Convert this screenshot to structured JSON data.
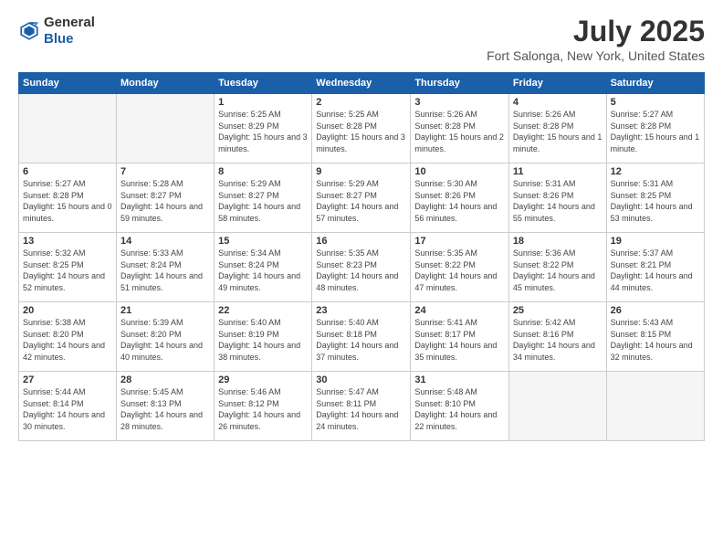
{
  "header": {
    "logo_general": "General",
    "logo_blue": "Blue",
    "title": "July 2025",
    "location": "Fort Salonga, New York, United States"
  },
  "weekdays": [
    "Sunday",
    "Monday",
    "Tuesday",
    "Wednesday",
    "Thursday",
    "Friday",
    "Saturday"
  ],
  "weeks": [
    [
      {
        "day": "",
        "sunrise": "",
        "sunset": "",
        "daylight": "",
        "empty": true
      },
      {
        "day": "",
        "sunrise": "",
        "sunset": "",
        "daylight": "",
        "empty": true
      },
      {
        "day": "1",
        "sunrise": "Sunrise: 5:25 AM",
        "sunset": "Sunset: 8:29 PM",
        "daylight": "Daylight: 15 hours and 3 minutes."
      },
      {
        "day": "2",
        "sunrise": "Sunrise: 5:25 AM",
        "sunset": "Sunset: 8:28 PM",
        "daylight": "Daylight: 15 hours and 3 minutes."
      },
      {
        "day": "3",
        "sunrise": "Sunrise: 5:26 AM",
        "sunset": "Sunset: 8:28 PM",
        "daylight": "Daylight: 15 hours and 2 minutes."
      },
      {
        "day": "4",
        "sunrise": "Sunrise: 5:26 AM",
        "sunset": "Sunset: 8:28 PM",
        "daylight": "Daylight: 15 hours and 1 minute."
      },
      {
        "day": "5",
        "sunrise": "Sunrise: 5:27 AM",
        "sunset": "Sunset: 8:28 PM",
        "daylight": "Daylight: 15 hours and 1 minute."
      }
    ],
    [
      {
        "day": "6",
        "sunrise": "Sunrise: 5:27 AM",
        "sunset": "Sunset: 8:28 PM",
        "daylight": "Daylight: 15 hours and 0 minutes."
      },
      {
        "day": "7",
        "sunrise": "Sunrise: 5:28 AM",
        "sunset": "Sunset: 8:27 PM",
        "daylight": "Daylight: 14 hours and 59 minutes."
      },
      {
        "day": "8",
        "sunrise": "Sunrise: 5:29 AM",
        "sunset": "Sunset: 8:27 PM",
        "daylight": "Daylight: 14 hours and 58 minutes."
      },
      {
        "day": "9",
        "sunrise": "Sunrise: 5:29 AM",
        "sunset": "Sunset: 8:27 PM",
        "daylight": "Daylight: 14 hours and 57 minutes."
      },
      {
        "day": "10",
        "sunrise": "Sunrise: 5:30 AM",
        "sunset": "Sunset: 8:26 PM",
        "daylight": "Daylight: 14 hours and 56 minutes."
      },
      {
        "day": "11",
        "sunrise": "Sunrise: 5:31 AM",
        "sunset": "Sunset: 8:26 PM",
        "daylight": "Daylight: 14 hours and 55 minutes."
      },
      {
        "day": "12",
        "sunrise": "Sunrise: 5:31 AM",
        "sunset": "Sunset: 8:25 PM",
        "daylight": "Daylight: 14 hours and 53 minutes."
      }
    ],
    [
      {
        "day": "13",
        "sunrise": "Sunrise: 5:32 AM",
        "sunset": "Sunset: 8:25 PM",
        "daylight": "Daylight: 14 hours and 52 minutes."
      },
      {
        "day": "14",
        "sunrise": "Sunrise: 5:33 AM",
        "sunset": "Sunset: 8:24 PM",
        "daylight": "Daylight: 14 hours and 51 minutes."
      },
      {
        "day": "15",
        "sunrise": "Sunrise: 5:34 AM",
        "sunset": "Sunset: 8:24 PM",
        "daylight": "Daylight: 14 hours and 49 minutes."
      },
      {
        "day": "16",
        "sunrise": "Sunrise: 5:35 AM",
        "sunset": "Sunset: 8:23 PM",
        "daylight": "Daylight: 14 hours and 48 minutes."
      },
      {
        "day": "17",
        "sunrise": "Sunrise: 5:35 AM",
        "sunset": "Sunset: 8:22 PM",
        "daylight": "Daylight: 14 hours and 47 minutes."
      },
      {
        "day": "18",
        "sunrise": "Sunrise: 5:36 AM",
        "sunset": "Sunset: 8:22 PM",
        "daylight": "Daylight: 14 hours and 45 minutes."
      },
      {
        "day": "19",
        "sunrise": "Sunrise: 5:37 AM",
        "sunset": "Sunset: 8:21 PM",
        "daylight": "Daylight: 14 hours and 44 minutes."
      }
    ],
    [
      {
        "day": "20",
        "sunrise": "Sunrise: 5:38 AM",
        "sunset": "Sunset: 8:20 PM",
        "daylight": "Daylight: 14 hours and 42 minutes."
      },
      {
        "day": "21",
        "sunrise": "Sunrise: 5:39 AM",
        "sunset": "Sunset: 8:20 PM",
        "daylight": "Daylight: 14 hours and 40 minutes."
      },
      {
        "day": "22",
        "sunrise": "Sunrise: 5:40 AM",
        "sunset": "Sunset: 8:19 PM",
        "daylight": "Daylight: 14 hours and 38 minutes."
      },
      {
        "day": "23",
        "sunrise": "Sunrise: 5:40 AM",
        "sunset": "Sunset: 8:18 PM",
        "daylight": "Daylight: 14 hours and 37 minutes."
      },
      {
        "day": "24",
        "sunrise": "Sunrise: 5:41 AM",
        "sunset": "Sunset: 8:17 PM",
        "daylight": "Daylight: 14 hours and 35 minutes."
      },
      {
        "day": "25",
        "sunrise": "Sunrise: 5:42 AM",
        "sunset": "Sunset: 8:16 PM",
        "daylight": "Daylight: 14 hours and 34 minutes."
      },
      {
        "day": "26",
        "sunrise": "Sunrise: 5:43 AM",
        "sunset": "Sunset: 8:15 PM",
        "daylight": "Daylight: 14 hours and 32 minutes."
      }
    ],
    [
      {
        "day": "27",
        "sunrise": "Sunrise: 5:44 AM",
        "sunset": "Sunset: 8:14 PM",
        "daylight": "Daylight: 14 hours and 30 minutes."
      },
      {
        "day": "28",
        "sunrise": "Sunrise: 5:45 AM",
        "sunset": "Sunset: 8:13 PM",
        "daylight": "Daylight: 14 hours and 28 minutes."
      },
      {
        "day": "29",
        "sunrise": "Sunrise: 5:46 AM",
        "sunset": "Sunset: 8:12 PM",
        "daylight": "Daylight: 14 hours and 26 minutes."
      },
      {
        "day": "30",
        "sunrise": "Sunrise: 5:47 AM",
        "sunset": "Sunset: 8:11 PM",
        "daylight": "Daylight: 14 hours and 24 minutes."
      },
      {
        "day": "31",
        "sunrise": "Sunrise: 5:48 AM",
        "sunset": "Sunset: 8:10 PM",
        "daylight": "Daylight: 14 hours and 22 minutes."
      },
      {
        "day": "",
        "sunrise": "",
        "sunset": "",
        "daylight": "",
        "empty": true
      },
      {
        "day": "",
        "sunrise": "",
        "sunset": "",
        "daylight": "",
        "empty": true
      }
    ]
  ]
}
